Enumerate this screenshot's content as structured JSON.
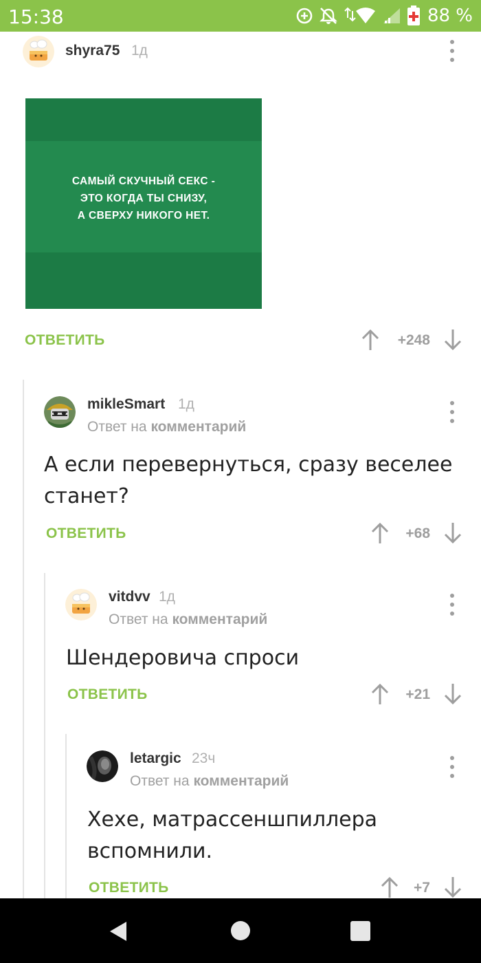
{
  "status_bar": {
    "time": "15:38",
    "battery": "88 %",
    "icons": [
      "data-saver-icon",
      "alarm-off-icon",
      "wifi-icon",
      "signal-icon",
      "battery-icon"
    ]
  },
  "colors": {
    "accent": "#8bc34a",
    "status_bar": "#8bc34a",
    "image_green": "#1c7b45"
  },
  "reply_label": "ОТВЕТИТЬ",
  "reply_to_prefix": "Ответ на",
  "reply_to_link": "комментарий",
  "comments": [
    {
      "username": "shyra75",
      "time": "1д",
      "image_text_lines": [
        "САМЫЙ СКУЧНЫЙ СЕКС -",
        "ЭТО КОГДА ТЫ СНИЗУ,",
        "А СВЕРХУ НИКОГО НЕТ."
      ],
      "rating": "+248"
    },
    {
      "username": "mikleSmart",
      "time": "1д",
      "text_lines": [
        "А если перевернуться, сразу веселее",
        "станет?"
      ],
      "rating": "+68"
    },
    {
      "username": "vitdvv",
      "time": "1д",
      "text_lines": [
        "Шендеровича спроси"
      ],
      "rating": "+21"
    },
    {
      "username": "letargic",
      "time": "23ч",
      "text_lines": [
        "Хехе, матрассеншпиллера",
        "вспомнили."
      ],
      "rating": "+7"
    }
  ],
  "nav": {
    "icons": [
      "back-icon",
      "home-icon",
      "recent-apps-icon"
    ]
  }
}
